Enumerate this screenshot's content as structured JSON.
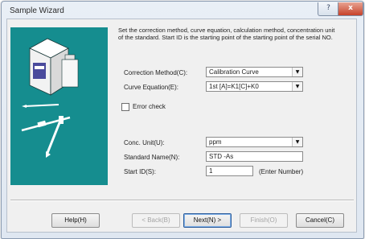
{
  "window": {
    "title": "Sample Wizard",
    "help_glyph": "?",
    "close_glyph": "x"
  },
  "description": "Set the correction method, curve equation, calculation method, concentration unit of the standard. Start ID is the starting point of the starting point of the serial NO.",
  "fields": {
    "correction_method_label": "Correction Method(C):",
    "correction_method_value": "Calibration Curve",
    "curve_equation_label": "Curve Equation(E):",
    "curve_equation_value": "1st [A]=K1[C]+K0",
    "error_check_label": "Error check",
    "conc_unit_label": "Conc. Unit(U):",
    "conc_unit_value": "ppm",
    "standard_name_label": "Standard Name(N):",
    "standard_name_value": "STD -As",
    "start_id_label": "Start ID(S):",
    "start_id_value": "1",
    "start_id_hint": "(Enter Number)"
  },
  "buttons": {
    "help": "Help(H)",
    "back": "< Back(B)",
    "next": "Next(N) >",
    "finish": "Finish(O)",
    "cancel": "Cancel(C)"
  },
  "icons": {
    "dropdown_arrow": "▼"
  },
  "colors": {
    "illustration_bg": "#158d8f",
    "dialog_bg": "#f0f0f0"
  }
}
